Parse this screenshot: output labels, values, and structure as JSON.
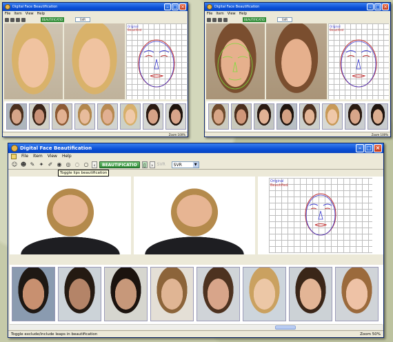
{
  "windows": {
    "top_left": {
      "title": "Digital Face Beautification",
      "menu": [
        "File",
        "Item",
        "View",
        "Help"
      ],
      "beautify_label": "BEAUTIFICATIO",
      "select_value": "SVR",
      "legend": [
        "Original",
        "Beautified"
      ],
      "status_zoom": "Zoom 100%"
    },
    "top_right": {
      "title": "Digital Face Beautification",
      "menu": [
        "File",
        "Item",
        "View",
        "Help"
      ],
      "beautify_label": "BEAUTIFICATIO",
      "select_value": "SVR",
      "legend": [
        "Original",
        "Beautified"
      ],
      "status_zoom": "Zoom 100%"
    },
    "main": {
      "title": "Digital Face Beautification",
      "menu": [
        "File",
        "Item",
        "View",
        "Help"
      ],
      "beautify_label": "BEAUTIFICATIO",
      "select_value": "SVR",
      "select_prefix": "SVR",
      "tooltip": "Toggle lips beautification",
      "legend": [
        "Original",
        "Beautified"
      ],
      "status_left": "Toggle exclude/include leaps in beautification",
      "status_zoom": "Zoom 50%"
    }
  },
  "thumbnails_main": [
    {
      "skin": "#c89070",
      "hair": "#1e1814",
      "bg": "#8a9bb0"
    },
    {
      "skin": "#b48468",
      "hair": "#241a12",
      "bg": "#ccd3d8"
    },
    {
      "skin": "#c7987a",
      "hair": "#1b130e",
      "bg": "#d6d6cf"
    },
    {
      "skin": "#e0b594",
      "hair": "#8c643a",
      "bg": "#e4dfd6"
    },
    {
      "skin": "#d8a58a",
      "hair": "#4d3220",
      "bg": "#d0d4d8"
    },
    {
      "skin": "#ecc7a6",
      "hair": "#caa160",
      "bg": "#cdd5dc"
    },
    {
      "skin": "#e3b596",
      "hair": "#3a2618",
      "bg": "#ccd2d6"
    },
    {
      "skin": "#eec2a6",
      "hair": "#9b6a3c",
      "bg": "#d0d4d8"
    }
  ],
  "thumbnails_top_left": [
    {
      "skin": "#d6a589",
      "hair": "#4b2f1d",
      "bg": "#aeb6bd"
    },
    {
      "skin": "#c99278",
      "hair": "#3a2518",
      "bg": "#d2d2c8"
    },
    {
      "skin": "#e2b192",
      "hair": "#8d5a34",
      "bg": "#cfcfc6"
    },
    {
      "skin": "#e8bc9c",
      "hair": "#b3884e",
      "bg": "#d7d9d6"
    },
    {
      "skin": "#e1b092",
      "hair": "#b88a52",
      "bg": "#d1d4d0"
    },
    {
      "skin": "#f0c9a8",
      "hair": "#d7b06b",
      "bg": "#cdd1c7"
    },
    {
      "skin": "#d6a287",
      "hair": "#2a1a12",
      "bg": "#d4d6d2"
    },
    {
      "skin": "#d8a48a",
      "hair": "#1f140e",
      "bg": "#d6d8d4"
    }
  ],
  "thumbnails_top_right": [
    {
      "skin": "#d7a586",
      "hair": "#6e4a2c",
      "bg": "#cbcbbf"
    },
    {
      "skin": "#cf9779",
      "hair": "#4a2e1c",
      "bg": "#c9c9bc"
    },
    {
      "skin": "#e1b295",
      "hair": "#2a1a12",
      "bg": "#c4c7c2"
    },
    {
      "skin": "#d3a083",
      "hair": "#1d130d",
      "bg": "#b8bfc4"
    },
    {
      "skin": "#e3b596",
      "hair": "#4b301e",
      "bg": "#cdd0cb"
    },
    {
      "skin": "#f0c8a8",
      "hair": "#c89a58",
      "bg": "#d7d9d5"
    },
    {
      "skin": "#d8a68a",
      "hair": "#2b1b12",
      "bg": "#cbced0"
    },
    {
      "skin": "#dcae90",
      "hair": "#1f140e",
      "bg": "#c9ccce"
    }
  ],
  "colors": {
    "titlebar": "#0a4fd6",
    "original_contour": "#3a3ad0",
    "beautified_contour": "#c03030",
    "beautify_button": "#2f8c36"
  },
  "icons": [
    "app-icon",
    "minimize-icon",
    "maximize-icon",
    "close-icon",
    "prev-arrow-icon",
    "next-arrow-icon",
    "dropdown-arrow-icon"
  ]
}
